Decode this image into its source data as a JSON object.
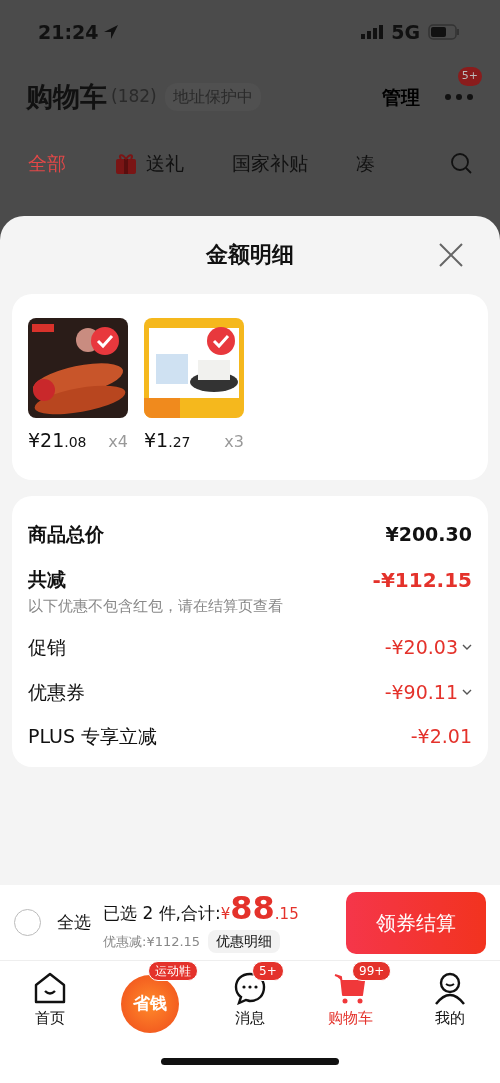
{
  "status_bar": {
    "time": "21:24",
    "network": "5G"
  },
  "header": {
    "title": "购物车",
    "count": "(182)",
    "address": "地址保护中",
    "manage": "管理",
    "more_badge": "5+"
  },
  "tabs": [
    {
      "label": "全部",
      "selected": true,
      "kind": "text"
    },
    {
      "label": "送礼",
      "selected": false,
      "kind": "gift"
    },
    {
      "label": "国家补贴",
      "selected": false,
      "kind": "text"
    },
    {
      "label": "凑",
      "selected": false,
      "kind": "text"
    }
  ],
  "sheet": {
    "title": "金额明细",
    "products": [
      {
        "price_main": "¥21",
        "price_decimal": ".08",
        "quantity": "x4",
        "selected": true
      },
      {
        "price_main": "¥1",
        "price_decimal": ".27",
        "quantity": "x3",
        "selected": true
      }
    ],
    "rows": [
      {
        "kind": "total",
        "label": "商品总价",
        "value": "¥200.30"
      },
      {
        "kind": "discount",
        "label": "共减",
        "value": "-¥112.15",
        "note": "以下优惠不包含红包，请在结算页查看"
      },
      {
        "kind": "item",
        "label": "促销",
        "value": "-¥20.03",
        "expandable": true
      },
      {
        "kind": "item",
        "label": "优惠券",
        "value": "-¥90.11",
        "expandable": true
      },
      {
        "kind": "item",
        "label": "PLUS 专享立减",
        "value": "-¥2.01"
      }
    ]
  },
  "checkout_bar": {
    "select_all": {
      "label": "全选",
      "checked": false
    },
    "summary": "已选 2 件,合计:",
    "total_main": "¥88",
    "total_decimal": ".15",
    "saved": "优惠减:¥112.15",
    "detail_button": "优惠明细",
    "checkout_button": "领券结算"
  },
  "bottom_nav": [
    {
      "label": "首页",
      "kind": "home",
      "selected": false
    },
    {
      "label": "省钱",
      "kind": "promo",
      "badge": "运动鞋",
      "selected": false
    },
    {
      "label": "消息",
      "kind": "message",
      "badge": "5+",
      "selected": false
    },
    {
      "label": "购物车",
      "kind": "cart",
      "badge": "99+",
      "selected": true
    },
    {
      "label": "我的",
      "kind": "profile",
      "selected": false
    }
  ]
}
